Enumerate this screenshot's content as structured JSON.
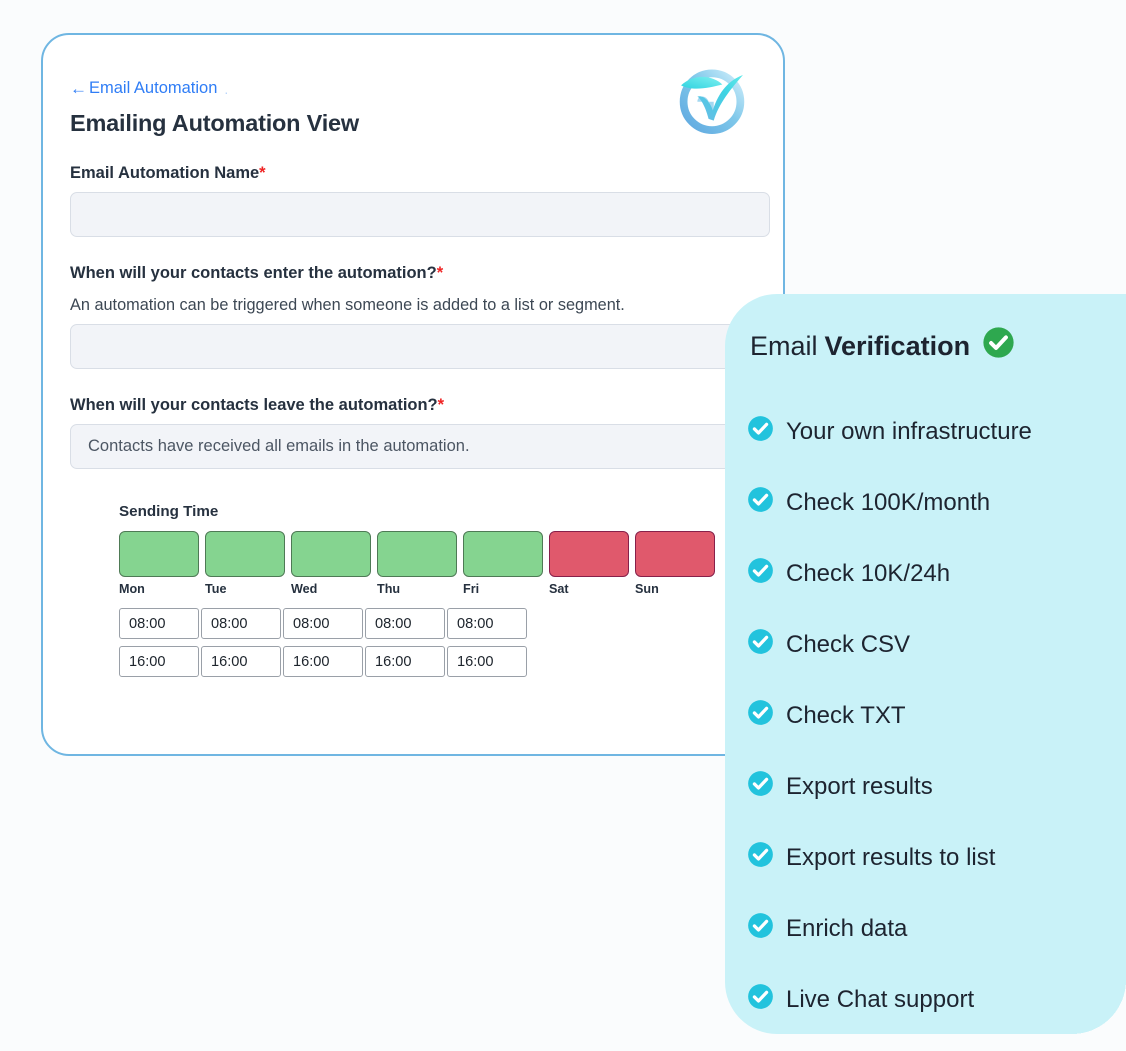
{
  "colors": {
    "card_border": "#6fb6e2",
    "breadcrumb_link": "#2f7df6",
    "required_star": "#ef2222",
    "panel_background": "#c9f2f8",
    "panel_check": "#22c3dd",
    "title_check": "#2ea84f",
    "day_on": "#85d490",
    "day_on_border": "#4e7a55",
    "day_off": "#e0596c",
    "day_off_border": "#87204a",
    "input_fill": "#f2f4f8",
    "input_border": "#d9dee6",
    "page_background": "#fafcfd"
  },
  "automation_card": {
    "breadcrumb": {
      "icon": "arrow-left-icon",
      "arrow": "←",
      "label": "Email Automation",
      "tail": "."
    },
    "page_title": "Emailing Automation View",
    "logo": {
      "icon": "checkmark-swoosh-logo",
      "alt": "Email verification brand logo"
    },
    "fields": [
      {
        "label": "Email Automation Name",
        "required": true,
        "required_mark": "*",
        "help": "",
        "value": "",
        "placeholder": ""
      },
      {
        "label": "When will your contacts enter the automation?",
        "required": true,
        "required_mark": "*",
        "help": "An automation can be triggered when someone is added to a list or segment.",
        "value": "",
        "placeholder": ""
      },
      {
        "label": "When will your contacts leave the automation?",
        "required": true,
        "required_mark": "*",
        "help": "",
        "value": "Contacts have received all emails in the automation.",
        "placeholder": ""
      }
    ],
    "schedule": {
      "title": "Sending Time",
      "days": [
        {
          "name": "Mon",
          "enabled": true
        },
        {
          "name": "Tue",
          "enabled": true
        },
        {
          "name": "Wed",
          "enabled": true
        },
        {
          "name": "Thu",
          "enabled": true
        },
        {
          "name": "Fri",
          "enabled": true
        },
        {
          "name": "Sat",
          "enabled": false
        },
        {
          "name": "Sun",
          "enabled": false
        }
      ],
      "time_rows": [
        [
          "08:00",
          "08:00",
          "08:00",
          "08:00",
          "08:00"
        ],
        [
          "16:00",
          "16:00",
          "16:00",
          "16:00",
          "16:00"
        ]
      ]
    }
  },
  "verification_panel": {
    "title": {
      "light": "Email",
      "bold": "Verification",
      "badge_icon": "check-circle-icon"
    },
    "features": [
      {
        "icon": "check-circle-icon",
        "label": "Your own infrastructure"
      },
      {
        "icon": "check-circle-icon",
        "label": "Check 100K/month"
      },
      {
        "icon": "check-circle-icon",
        "label": "Check 10K/24h"
      },
      {
        "icon": "check-circle-icon",
        "label": "Check CSV"
      },
      {
        "icon": "check-circle-icon",
        "label": "Check TXT"
      },
      {
        "icon": "check-circle-icon",
        "label": "Export results"
      },
      {
        "icon": "check-circle-icon",
        "label": "Export results to list"
      },
      {
        "icon": "check-circle-icon",
        "label": "Enrich data"
      },
      {
        "icon": "check-circle-icon",
        "label": "Live Chat support"
      }
    ]
  }
}
